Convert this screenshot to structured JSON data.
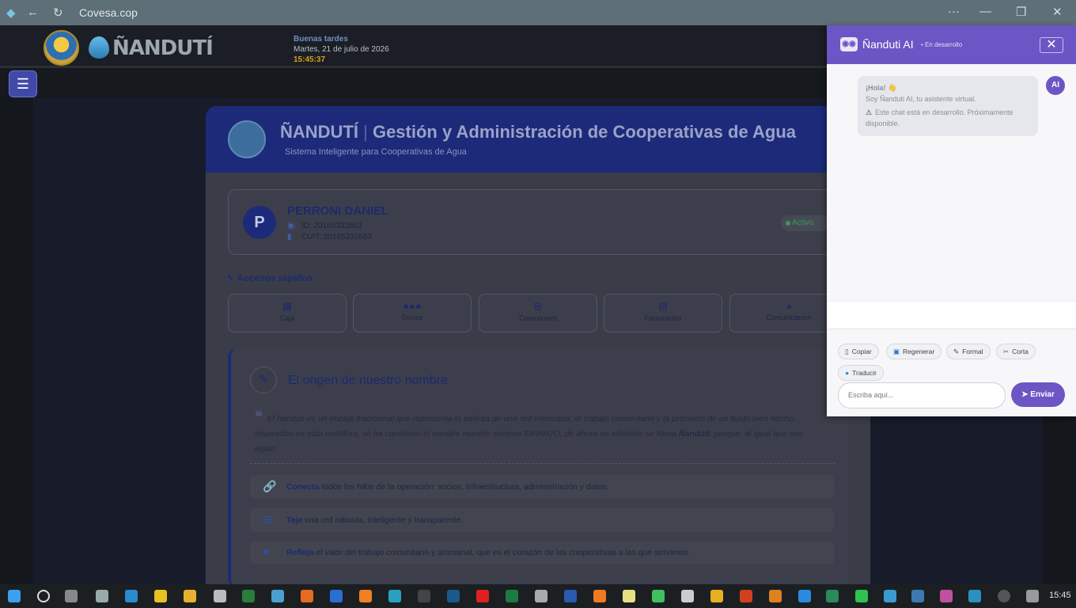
{
  "browser": {
    "url": "Covesa.cop",
    "more": "···",
    "minimize": "—",
    "restore": "❐",
    "close": "✕",
    "back": "←",
    "reload": "↻"
  },
  "header": {
    "logo_text": "ÑANDUTÍ",
    "greeting": "Buenas tardes",
    "date": "Martes, 21 de julio de 2026",
    "time": "15:45:37"
  },
  "menu_button": "☰",
  "card": {
    "title_brand": "ÑANDUTÍ",
    "title_sep": " | ",
    "title_rest": "Gestión y Administración de Cooperativas de Agua",
    "subtitle": "Sistema Inteligente para Cooperativas de Agua"
  },
  "user": {
    "initial": "P",
    "name": "PERRONI DANIEL",
    "id": "ID: 20165332653",
    "cuit": "CUIT: 20165332653",
    "status": "Activo"
  },
  "quick": {
    "title": "Accesos rápidos",
    "items": [
      {
        "label": "Caja",
        "icon": "cash-register-icon"
      },
      {
        "label": "Socios",
        "icon": "users-icon"
      },
      {
        "label": "Conexiones",
        "icon": "network-icon"
      },
      {
        "label": "Facturación",
        "icon": "invoice-icon"
      },
      {
        "label": "Comunicacion",
        "icon": "pie-chart-icon"
      }
    ]
  },
  "origin": {
    "title": "El origen de nuestro nombre",
    "quote_a": "El ñandutí es un encaje tradicional que representa la belleza de una red intrincada, el trabajo comunitario y la precisión de un tejido bien hecho. Inspirados en esta metáfora, se ha cambiado el nombre nuestro sistema SIHAH2O, de ahora en adelante se llama ",
    "quote_b": "Ñandutí",
    "quote_c": ", porque, al igual que ese tejido:",
    "features": [
      {
        "bold": "Conecta",
        "text": " todos los hilos de la operación: socios, infraestructura, administración y datos."
      },
      {
        "bold": "Teje",
        "text": " una red robusta, inteligente y transparente."
      },
      {
        "bold": "Refleja",
        "text": " el valor del trabajo comunitario y artesanal, que es el corazón de las cooperativas a las que servimos."
      }
    ]
  },
  "chat": {
    "title": "Ñanduti AI",
    "dev": "• En desarrollo",
    "badge": "AI",
    "msg_hi": "¡Hola! 👋",
    "msg_intro": "Soy Ñanduti AI, tu asistente virtual.",
    "msg_warn": "Este chat está en desarrollo. Próximamente disponible.",
    "actions": [
      "Copiar",
      "Regenerar",
      "Formal",
      "Corta",
      "Traducir"
    ],
    "placeholder": "Escriba aquí...",
    "send": "Enviar"
  },
  "taskbar": {
    "time": "15:45"
  }
}
